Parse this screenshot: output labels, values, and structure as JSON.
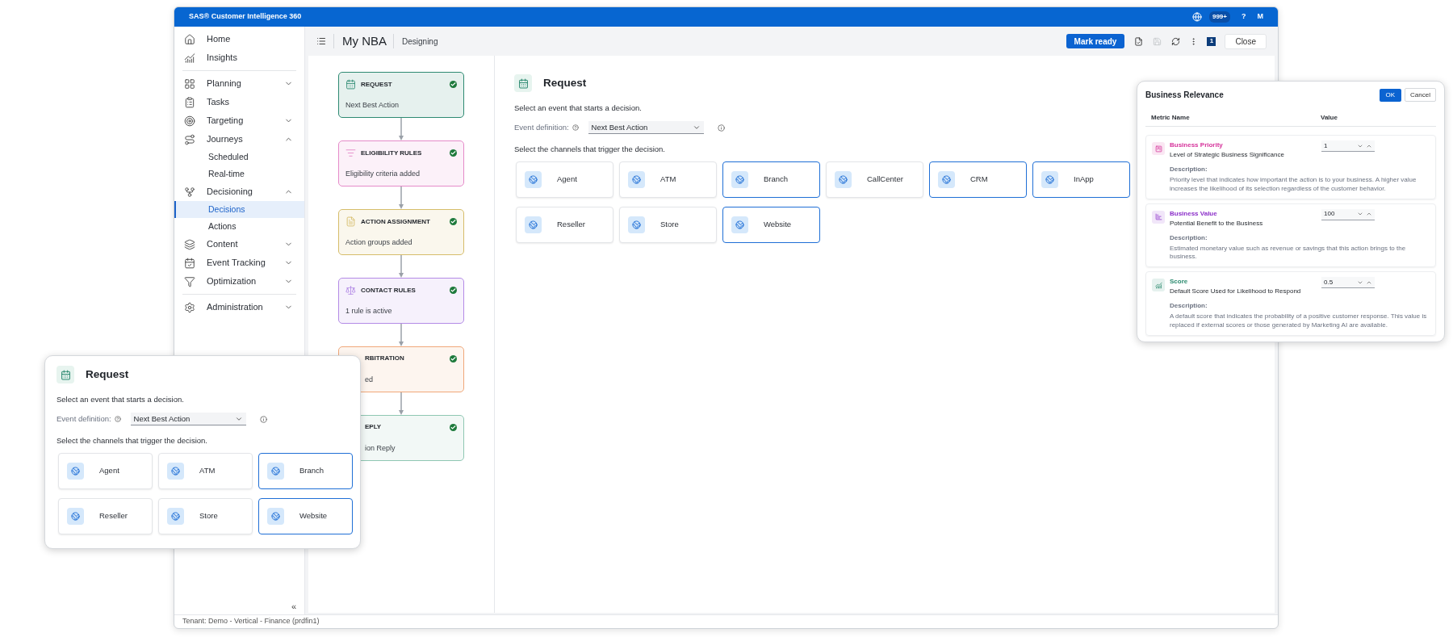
{
  "topbar": {
    "title": "SAS® Customer Intelligence 360",
    "notifications": "999+",
    "help": "?",
    "user": "M"
  },
  "sidebar": {
    "groups": [
      [
        {
          "label": "Home"
        },
        {
          "label": "Insights"
        }
      ],
      [
        {
          "label": "Planning",
          "expanded": false
        },
        {
          "label": "Tasks"
        },
        {
          "label": "Targeting",
          "expanded": false
        },
        {
          "label": "Journeys",
          "expanded": true,
          "children": [
            {
              "label": "Scheduled",
              "selected": false
            },
            {
              "label": "Real-time",
              "selected": false
            }
          ]
        },
        {
          "label": "Decisioning",
          "expanded": true,
          "children": [
            {
              "label": "Decisions",
              "selected": true
            },
            {
              "label": "Actions",
              "selected": false
            }
          ]
        },
        {
          "label": "Content",
          "expanded": false
        },
        {
          "label": "Event Tracking",
          "expanded": false
        },
        {
          "label": "Optimization",
          "expanded": false
        }
      ],
      [
        {
          "label": "Administration",
          "expanded": false
        }
      ]
    ],
    "collapse": "«"
  },
  "header": {
    "title": "My NBA",
    "status": "Designing",
    "primary_button": "Mark ready",
    "badge": "1",
    "close_button": "Close"
  },
  "flow": {
    "nodes": [
      {
        "title": "REQUEST",
        "subtitle": "Next Best Action",
        "color": "#2e8a72",
        "done": true,
        "partly_hidden": false
      },
      {
        "title": "ELIGIBILITY RULES",
        "subtitle": "Eligibility criteria added",
        "color": "#e58bc9",
        "done": true,
        "partly_hidden": false
      },
      {
        "title": "ACTION ASSIGNMENT",
        "subtitle": "Action groups added",
        "color": "#d6bd6a",
        "done": true,
        "partly_hidden": false
      },
      {
        "title": "CONTACT RULES",
        "subtitle": "1 rule is active",
        "color": "#b48be6",
        "done": true,
        "partly_hidden": false
      },
      {
        "title": "RBITRATION",
        "subtitle": "ed",
        "color": "#f0a87a",
        "done": true,
        "partly_hidden": true
      },
      {
        "title": "EPLY",
        "subtitle": "ion Reply",
        "color": "#8fc7b3",
        "done": true,
        "partly_hidden": true
      }
    ]
  },
  "detail": {
    "title": "Request",
    "prompt": "Select an event that starts a decision.",
    "event_label": "Event definition:",
    "event_value": "Next Best Action",
    "channels_prompt": "Select the channels that trigger the decision.",
    "channels": [
      {
        "label": "Agent",
        "selected": false
      },
      {
        "label": "ATM",
        "selected": false
      },
      {
        "label": "Branch",
        "selected": true
      },
      {
        "label": "CallCenter",
        "selected": false
      },
      {
        "label": "CRM",
        "selected": true
      },
      {
        "label": "InApp",
        "selected": true
      },
      {
        "label": "Reseller",
        "selected": false
      },
      {
        "label": "Store",
        "selected": false
      },
      {
        "label": "Website",
        "selected": true
      }
    ]
  },
  "footer": {
    "tenant": "Tenant: Demo - Vertical - Finance (prdfin1)"
  },
  "request_card": {
    "title": "Request",
    "prompt": "Select an event that starts a decision.",
    "event_label": "Event definition:",
    "event_value": "Next Best Action",
    "channels_prompt": "Select the channels that trigger the decision.",
    "channels": [
      {
        "label": "Agent",
        "selected": false
      },
      {
        "label": "ATM",
        "selected": false
      },
      {
        "label": "Branch",
        "selected": true
      },
      {
        "label": "Reseller",
        "selected": false
      },
      {
        "label": "Store",
        "selected": false
      },
      {
        "label": "Website",
        "selected": true
      }
    ]
  },
  "business_relevance": {
    "title": "Business Relevance",
    "ok_button": "OK",
    "cancel_button": "Cancel",
    "columns": [
      "Metric Name",
      "Value"
    ],
    "metrics": [
      {
        "category": "Business Priority",
        "color": "#d6339b",
        "name": "Level of Strategic Business Significance",
        "value": "1",
        "description_label": "Description:",
        "description": "Priority level that indicates how important the action is to your business. A higher value increases the likelihood of its selection regardless of the customer behavior."
      },
      {
        "category": "Business Value",
        "color": "#8b2fc9",
        "name": "Potential Benefit to the Business",
        "value": "100",
        "description_label": "Description:",
        "description": "Estimated monetary value such as revenue or savings that this action brings to the business."
      },
      {
        "category": "Score",
        "color": "#2a8a6e",
        "name": "Default Score Used for Likelihood to Respond",
        "value": "0.5",
        "description_label": "Description:",
        "description": "A default score that indicates the probability of a positive customer response. This value is replaced if external scores or those generated by Marketing AI are available."
      }
    ]
  }
}
